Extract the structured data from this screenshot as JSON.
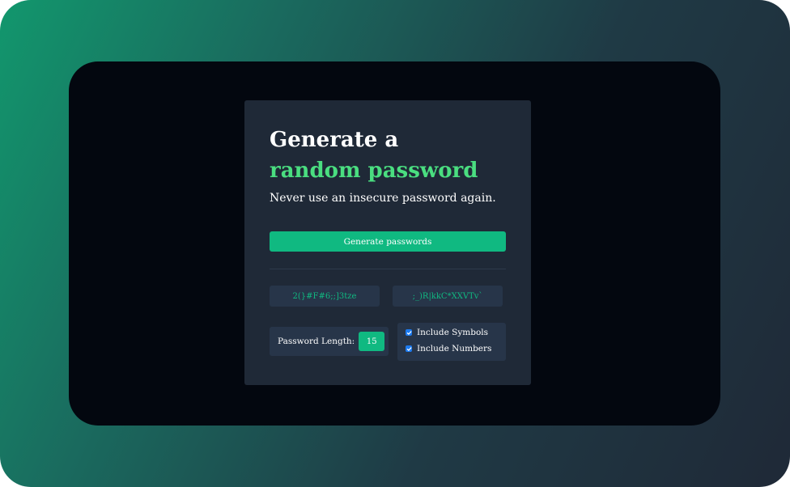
{
  "card": {
    "title_line1": "Generate a",
    "title_line2": "random password",
    "subtitle": "Never use an insecure password again.",
    "generate_button_label": "Generate passwords"
  },
  "passwords": [
    "2(}#F#6;;]3tze",
    ";_)R|kkC*XXVTv`"
  ],
  "options": {
    "length_label": "Password Length:",
    "length_value": "15",
    "include_symbols_label": "Include Symbols",
    "include_symbols_checked": true,
    "include_numbers_label": "Include Numbers",
    "include_numbers_checked": true
  },
  "colors": {
    "accent": "#10b981",
    "accent_text": "#4ade80",
    "card_bg": "#1f2937",
    "field_bg": "#273549",
    "checkbox": "#1d7bf0"
  }
}
